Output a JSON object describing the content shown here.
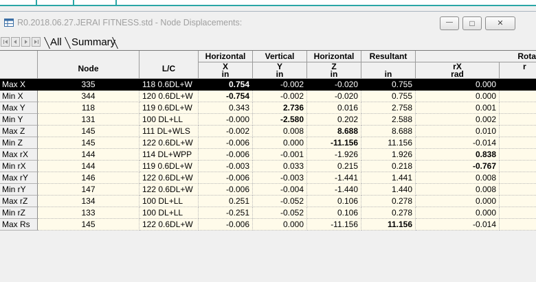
{
  "window": {
    "title": "R0.2018.06.27.JERAI FITNESS.std - Node Displacements:",
    "minimize_glyph": "—",
    "maximize_glyph": "□",
    "close_glyph": "✕"
  },
  "tabs": [
    {
      "label": "All"
    },
    {
      "label": "Summary"
    }
  ],
  "table": {
    "header_top": [
      "",
      "",
      "",
      "Horizontal",
      "Vertical",
      "Horizontal",
      "Resultant",
      "Rota"
    ],
    "header_mid": [
      "",
      "Node",
      "L/C",
      "X",
      "Y",
      "Z",
      "",
      "rX"
    ],
    "header_units": [
      "",
      "",
      "",
      "in",
      "in",
      "in",
      "in",
      "rad"
    ],
    "rows": [
      {
        "label": "Max X",
        "node": "335",
        "lc": "118 0.6DL+W",
        "x": "0.754",
        "y": "-0.002",
        "z": "-0.020",
        "res": "0.755",
        "rx": "0.000",
        "bold": "x",
        "selected": true
      },
      {
        "label": "Min X",
        "node": "344",
        "lc": "120 0.6DL+W",
        "x": "-0.754",
        "y": "-0.002",
        "z": "-0.020",
        "res": "0.755",
        "rx": "0.000",
        "bold": "x"
      },
      {
        "label": "Max Y",
        "node": "118",
        "lc": "119 0.6DL+W",
        "x": "0.343",
        "y": "2.736",
        "z": "0.016",
        "res": "2.758",
        "rx": "0.001",
        "bold": "y"
      },
      {
        "label": "Min Y",
        "node": "131",
        "lc": "100 DL+LL",
        "x": "-0.000",
        "y": "-2.580",
        "z": "0.202",
        "res": "2.588",
        "rx": "0.002",
        "bold": "y"
      },
      {
        "label": "Max Z",
        "node": "145",
        "lc": "111 DL+WLS",
        "x": "-0.002",
        "y": "0.008",
        "z": "8.688",
        "res": "8.688",
        "rx": "0.010",
        "bold": "z"
      },
      {
        "label": "Min Z",
        "node": "145",
        "lc": "122 0.6DL+W",
        "x": "-0.006",
        "y": "0.000",
        "z": "-11.156",
        "res": "11.156",
        "rx": "-0.014",
        "bold": "z"
      },
      {
        "label": "Max rX",
        "node": "144",
        "lc": "114 DL+WPP",
        "x": "-0.006",
        "y": "-0.001",
        "z": "-1.926",
        "res": "1.926",
        "rx": "0.838",
        "bold": "rx"
      },
      {
        "label": "Min rX",
        "node": "144",
        "lc": "119 0.6DL+W",
        "x": "-0.003",
        "y": "0.033",
        "z": "0.215",
        "res": "0.218",
        "rx": "-0.767",
        "bold": "rx"
      },
      {
        "label": "Max rY",
        "node": "146",
        "lc": "122 0.6DL+W",
        "x": "-0.006",
        "y": "-0.003",
        "z": "-1.441",
        "res": "1.441",
        "rx": "0.008",
        "bold": ""
      },
      {
        "label": "Min rY",
        "node": "147",
        "lc": "122 0.6DL+W",
        "x": "-0.006",
        "y": "-0.004",
        "z": "-1.440",
        "res": "1.440",
        "rx": "0.008",
        "bold": ""
      },
      {
        "label": "Max rZ",
        "node": "134",
        "lc": "100 DL+LL",
        "x": "0.251",
        "y": "-0.052",
        "z": "0.106",
        "res": "0.278",
        "rx": "0.000",
        "bold": ""
      },
      {
        "label": "Min rZ",
        "node": "133",
        "lc": "100 DL+LL",
        "x": "-0.251",
        "y": "-0.052",
        "z": "0.106",
        "res": "0.278",
        "rx": "0.000",
        "bold": ""
      },
      {
        "label": "Max Rs",
        "node": "145",
        "lc": "122 0.6DL+W",
        "x": "-0.006",
        "y": "0.000",
        "z": "-11.156",
        "res": "11.156",
        "rx": "-0.014",
        "bold": "res"
      }
    ]
  },
  "colors": {
    "accent": "#2aa6a6",
    "cell_bg": "#fffbea",
    "selected_bg": "#000000"
  }
}
